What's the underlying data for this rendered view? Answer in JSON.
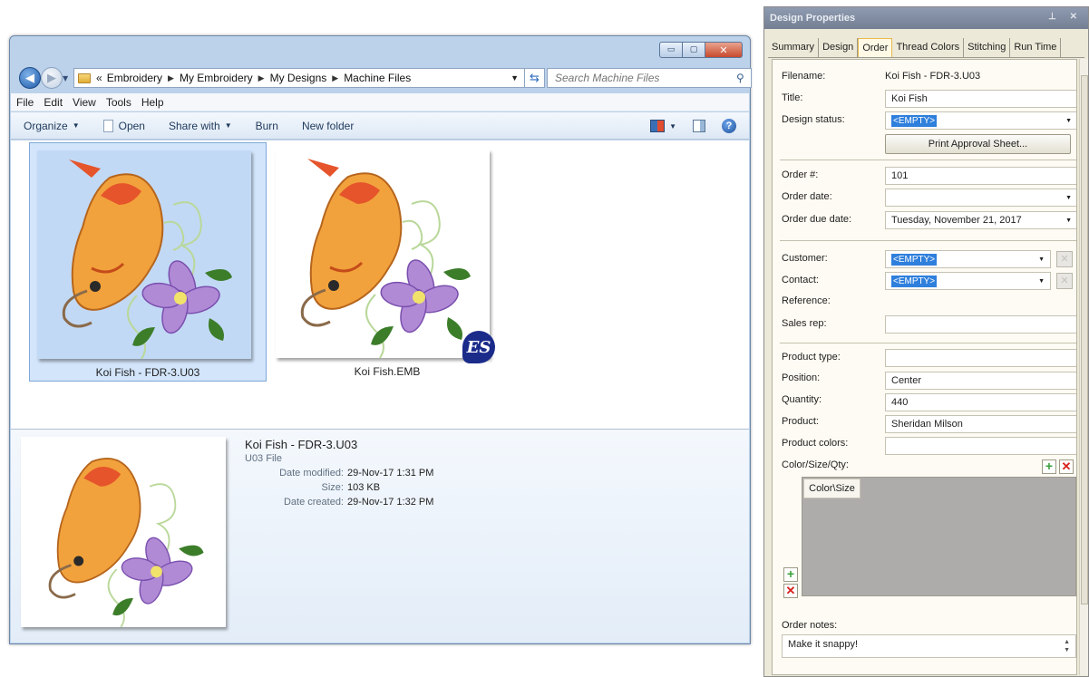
{
  "explorer": {
    "window_buttons": {
      "minimize": "▭",
      "maximize": "▢",
      "close": "✕"
    },
    "breadcrumb": [
      "Embroidery",
      "My Embroidery",
      "My Designs",
      "Machine Files"
    ],
    "breadcrumb_prefix": "«",
    "search_placeholder": "Search Machine Files",
    "menu": [
      "File",
      "Edit",
      "View",
      "Tools",
      "Help"
    ],
    "commands": {
      "organize": "Organize",
      "open": "Open",
      "share_with": "Share with",
      "burn": "Burn",
      "new_folder": "New folder"
    },
    "files": [
      {
        "name": "Koi Fish - FDR-3.U03",
        "selected": true
      },
      {
        "name": "Koi Fish.EMB",
        "selected": false,
        "badge": "ES"
      }
    ],
    "details": {
      "name": "Koi Fish - FDR-3.U03",
      "type": "U03 File",
      "rows": [
        {
          "key": "Date modified:",
          "value": "29-Nov-17 1:31 PM"
        },
        {
          "key": "Size:",
          "value": "103 KB"
        },
        {
          "key": "Date created:",
          "value": "29-Nov-17 1:32 PM"
        }
      ]
    }
  },
  "panel": {
    "title": "Design Properties",
    "title_controls": "⊥ ✕",
    "tabs": [
      "Summary",
      "Design",
      "Order",
      "Thread Colors",
      "Stitching",
      "Run Time"
    ],
    "active_tab": "Order",
    "labels": {
      "filename": "Filename:",
      "title": "Title:",
      "design_status": "Design status:",
      "order_no": "Order #:",
      "order_date": "Order date:",
      "order_due_date": "Order due date:",
      "customer": "Customer:",
      "contact": "Contact:",
      "reference": "Reference:",
      "sales_rep": "Sales rep:",
      "product_type": "Product type:",
      "position": "Position:",
      "quantity": "Quantity:",
      "product": "Product:",
      "product_colors": "Product colors:",
      "color_size_qty": "Color/Size/Qty:",
      "order_notes": "Order notes:"
    },
    "values": {
      "filename": "Koi Fish - FDR-3.U03",
      "title": "Koi Fish",
      "design_status": "<EMPTY>",
      "order_no": "101",
      "order_date": "",
      "order_due_date": "Tuesday, November 21, 2017",
      "customer": "<EMPTY>",
      "contact": "<EMPTY>",
      "reference": "",
      "sales_rep": "",
      "product_type": "",
      "position": "Center",
      "quantity": "440",
      "product": "Sheridan Milson",
      "product_colors": "",
      "order_notes": "Make it snappy!"
    },
    "print_button": "Print Approval Sheet...",
    "grid_header": "Color\\Size"
  },
  "colors": {
    "selection_blue": "#2f7fdc",
    "active_tab_border": "#e9b94a",
    "explorer_frame": "#bcd2ea"
  }
}
